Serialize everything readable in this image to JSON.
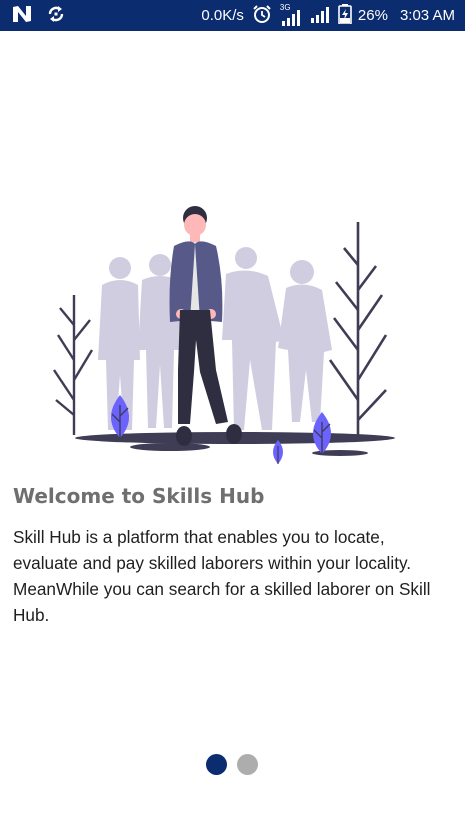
{
  "status_bar": {
    "network_speed": "0.0K/s",
    "network_type": "3G",
    "battery_percent": "26%",
    "time": "3:03 AM",
    "icons": [
      "n-logo-icon",
      "sync-icon",
      "alarm-icon",
      "signal-3g-icon",
      "signal-icon",
      "battery-charging-icon"
    ]
  },
  "onboarding": {
    "title": "Welcome to Skills Hub",
    "description": "Skill Hub is a platform that enables you to locate, evaluate and pay skilled laborers within your locality. MeanWhile you can search for a skilled laborer on Skill Hub."
  },
  "pager": {
    "page_count": 2,
    "active_page": 1
  },
  "colors": {
    "status_bar": "#0b2c6e",
    "title": "#6f6f6f",
    "body_text": "#1f1f1f",
    "dot_active": "#0b2c6e",
    "dot_inactive": "#adadad",
    "accent_purple": "#6c63ff",
    "silhouette": "#d0cde1",
    "dark": "#3f3d56"
  }
}
